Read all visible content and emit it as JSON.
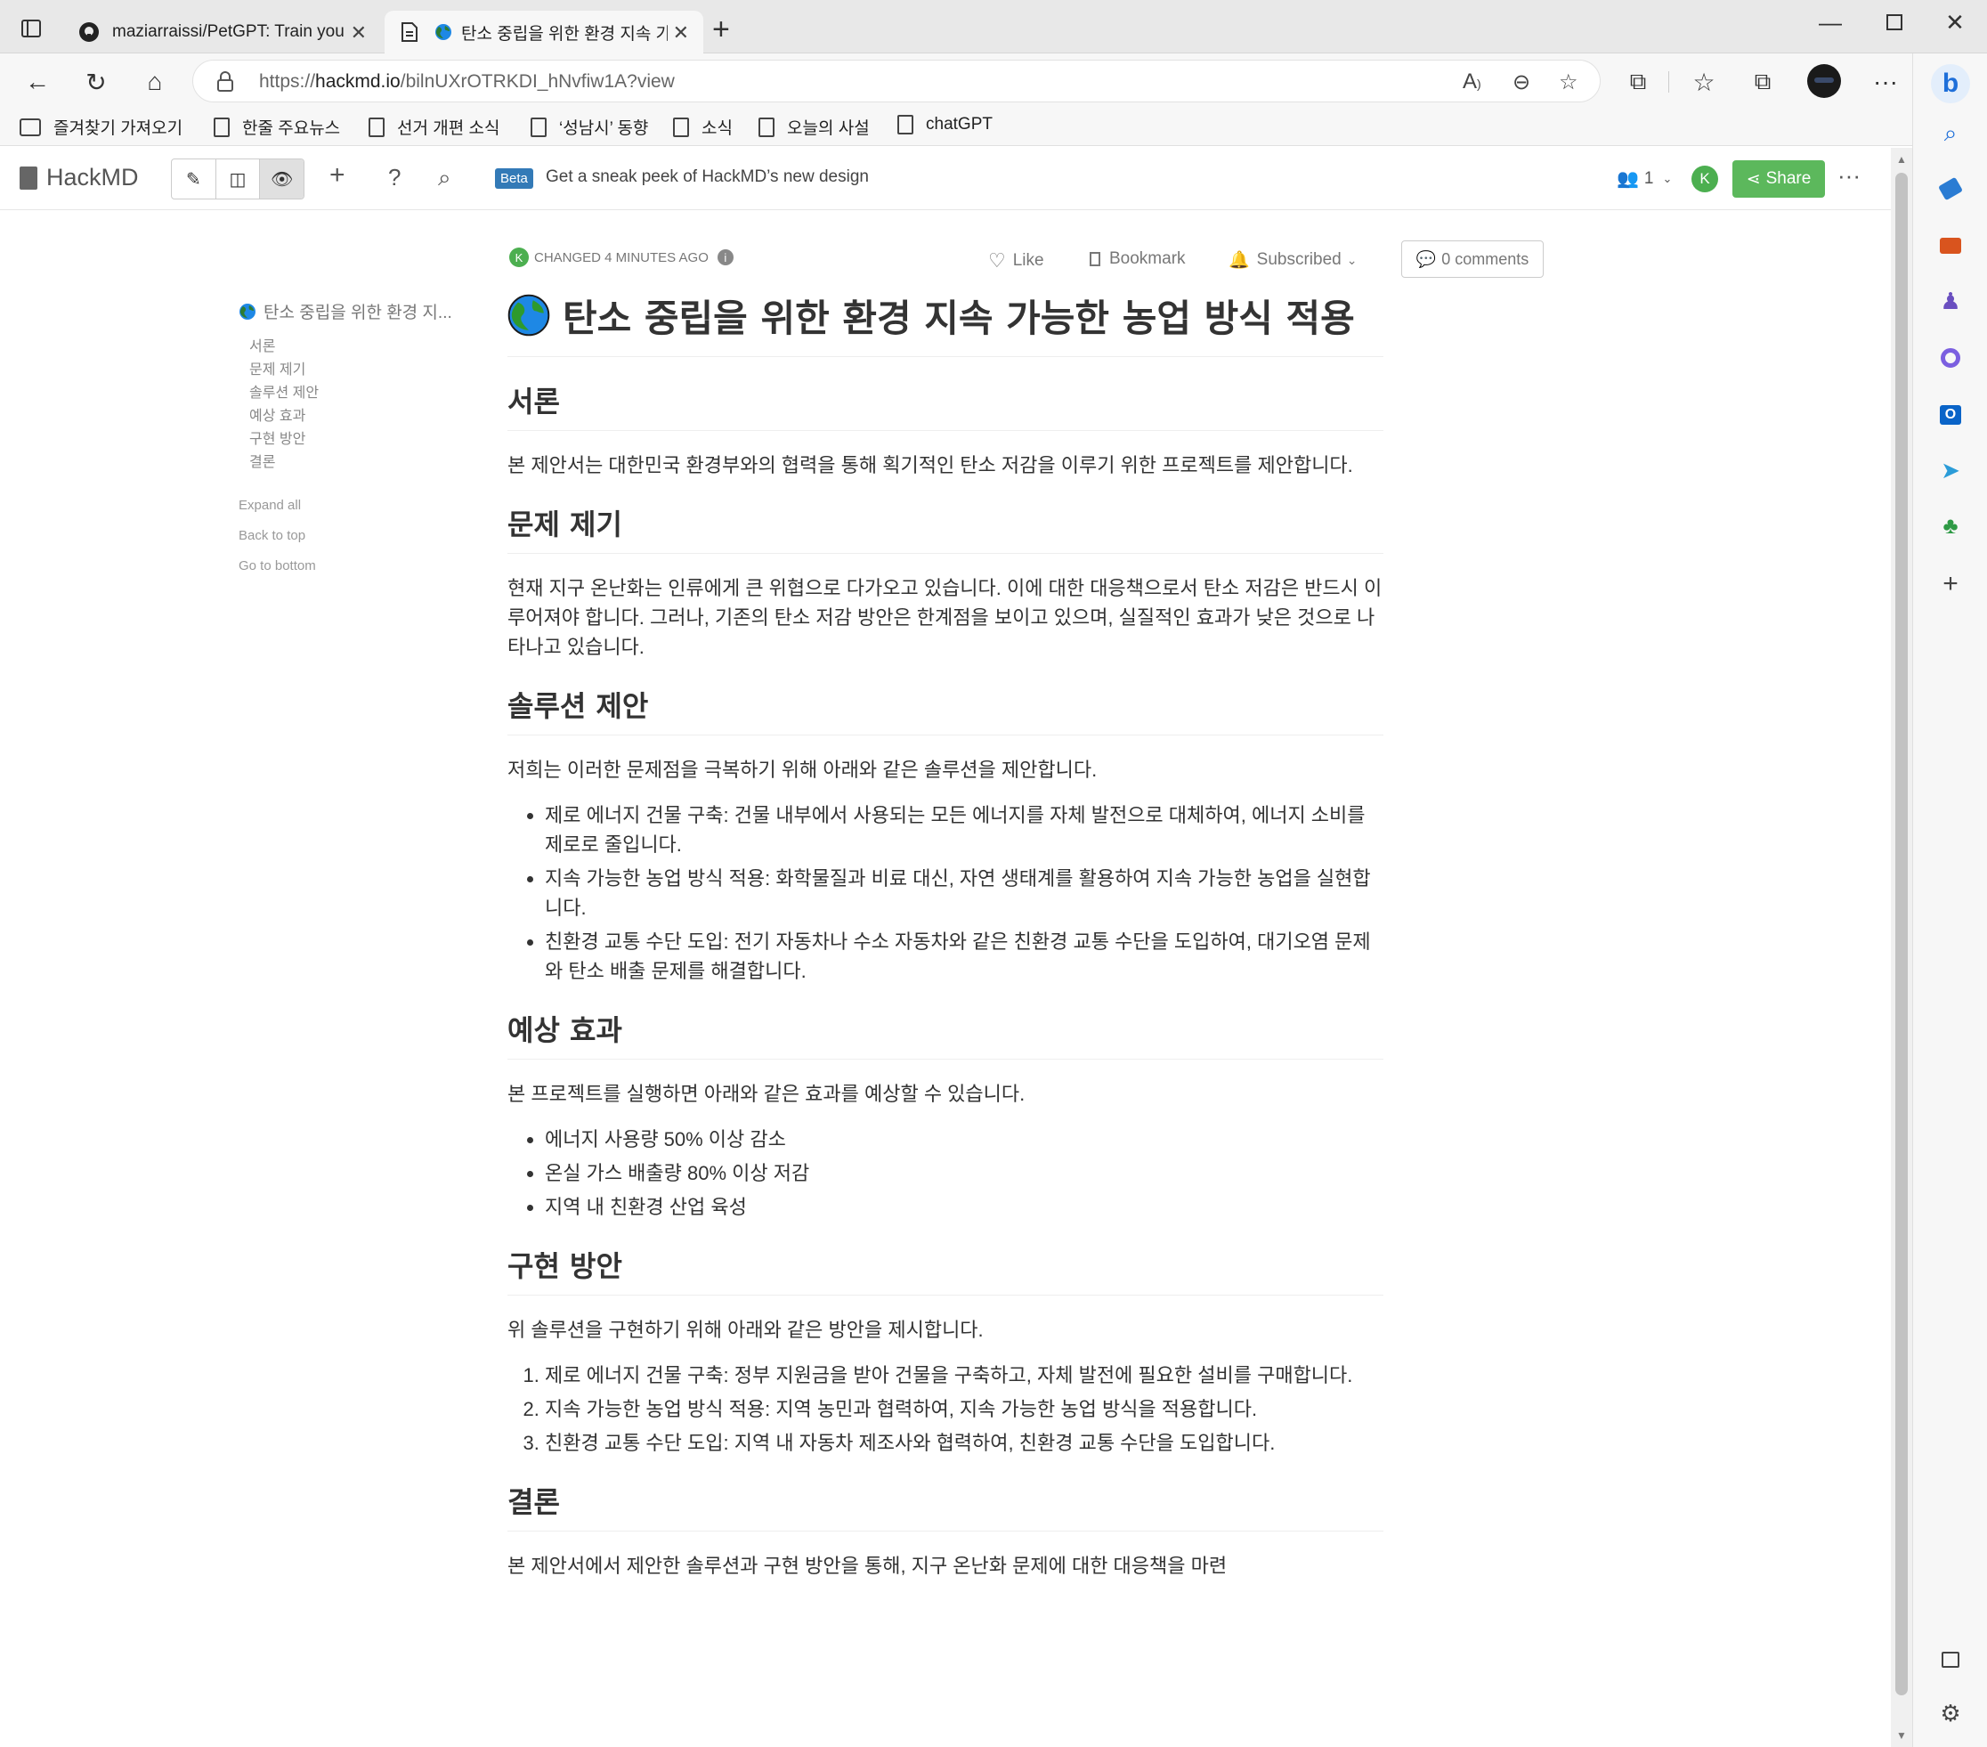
{
  "browser": {
    "tabs": [
      {
        "label": "maziarraissi/PetGPT: Train your o"
      },
      {
        "label": "탄소 중립을 위한 환경 지속 가"
      }
    ],
    "new_tab_symbol": "+",
    "url_prefix": "https://",
    "url_domain": "hackmd.io",
    "url_path": "/bilnUXrOTRKDI_hNvfiw1A?view",
    "bookmarks": [
      {
        "label": "즐겨찾기 가져오기"
      },
      {
        "label": "한줄 주요뉴스"
      },
      {
        "label": "선거 개편 소식"
      },
      {
        "label": "‘성남시’ 동향"
      },
      {
        "label": "소식"
      },
      {
        "label": "오늘의 사설"
      },
      {
        "label": "chatGPT"
      }
    ]
  },
  "hackmd": {
    "logo": "HackMD",
    "beta_badge": "Beta",
    "beta_text": "Get a sneak peek of HackMD’s new design",
    "online_count": "1",
    "avatar_letter": "K",
    "share_label": "Share",
    "meta": {
      "avatar_letter": "K",
      "changed": "CHANGED 4 MINUTES AGO",
      "like": "Like",
      "bookmark": "Bookmark",
      "subscribed": "Subscribed",
      "comments": "0 comments"
    }
  },
  "toc": {
    "title": "탄소 중립을 위한 환경 지...",
    "items": [
      "서론",
      "문제 제기",
      "솔루션 제안",
      "예상 효과",
      "구현 방안",
      "결론"
    ],
    "expand_all": "Expand all",
    "back_to_top": "Back to top",
    "go_to_bottom": "Go to bottom"
  },
  "document": {
    "title": "탄소 중립을 위한 환경 지속 가능한 농업 방식 적용",
    "intro_heading": "서론",
    "intro_text": "본 제안서는 대한민국 환경부와의 협력을 통해 획기적인 탄소 저감을 이루기 위한 프로젝트를 제안합니다.",
    "problem_heading": "문제 제기",
    "problem_text": "현재 지구 온난화는 인류에게 큰 위협으로 다가오고 있습니다. 이에 대한 대응책으로서 탄소 저감은 반드시 이루어져야 합니다. 그러나, 기존의 탄소 저감 방안은 한계점을 보이고 있으며, 실질적인 효과가 낮은 것으로 나타나고 있습니다.",
    "solution_heading": "솔루션 제안",
    "solution_text": "저희는 이러한 문제점을 극복하기 위해 아래와 같은 솔루션을 제안합니다.",
    "solution_items": [
      "제로 에너지 건물 구축: 건물 내부에서 사용되는 모든 에너지를 자체 발전으로 대체하여, 에너지 소비를 제로로 줄입니다.",
      "지속 가능한 농업 방식 적용: 화학물질과 비료 대신, 자연 생태계를 활용하여 지속 가능한 농업을 실현합니다.",
      "친환경 교통 수단 도입: 전기 자동차나 수소 자동차와 같은 친환경 교통 수단을 도입하여, 대기오염 문제와 탄소 배출 문제를 해결합니다."
    ],
    "effect_heading": "예상 효과",
    "effect_text": "본 프로젝트를 실행하면 아래와 같은 효과를 예상할 수 있습니다.",
    "effect_items": [
      "에너지 사용량 50% 이상 감소",
      "온실 가스 배출량 80% 이상 저감",
      "지역 내 친환경 산업 육성"
    ],
    "impl_heading": "구현 방안",
    "impl_text": "위 솔루션을 구현하기 위해 아래와 같은 방안을 제시합니다.",
    "impl_items": [
      "제로 에너지 건물 구축: 정부 지원금을 받아 건물을 구축하고, 자체 발전에 필요한 설비를 구매합니다.",
      "지속 가능한 농업 방식 적용: 지역 농민과 협력하여, 지속 가능한 농업 방식을 적용합니다.",
      "친환경 교통 수단 도입: 지역 내 자동차 제조사와 협력하여, 친환경 교통 수단을 도입합니다."
    ],
    "conclusion_heading": "결론",
    "conclusion_text": "본 제안서에서 제안한 솔루션과 구현 방안을 통해, 지구 온난화 문제에 대한 대응책을 마련"
  },
  "colors": {
    "share_green": "#5cb85c",
    "beta_blue": "#337ab7",
    "avatar_green": "#4caf50"
  }
}
